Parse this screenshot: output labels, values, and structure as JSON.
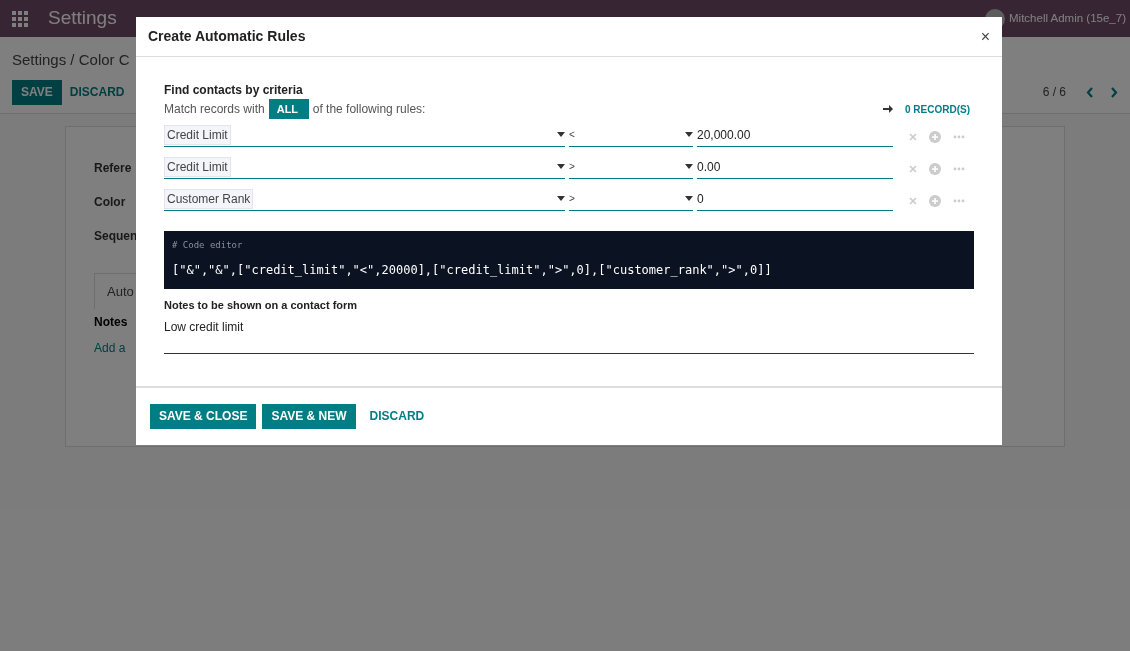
{
  "navbar": {
    "app_title": "Settings",
    "user": "Mitchell Admin (15e_7)"
  },
  "control_panel": {
    "breadcrumb": "Settings / Color C",
    "buttons": [
      {
        "label": "SAVE",
        "kind": "primary"
      },
      {
        "label": "DISCARD",
        "kind": "link"
      }
    ],
    "pager": "6 / 6"
  },
  "form": {
    "labels": [
      "Refere",
      "Color",
      "Sequen"
    ],
    "tab": "Auto",
    "table_header": "Notes",
    "add_line": "Add a"
  },
  "dialog": {
    "title": "Create Automatic Rules",
    "close": "×",
    "criteria_heading": "Find contacts by criteria",
    "match_prefix": "Match records with",
    "match_mode": "ALL",
    "match_suffix": "of the following rules:",
    "record_count": "0 RECORD(S)",
    "rules": [
      {
        "field": "Credit Limit",
        "operator": "<",
        "value": "20,000.00"
      },
      {
        "field": "Credit Limit",
        "operator": ">",
        "value": "0.00"
      },
      {
        "field": "Customer Rank",
        "operator": ">",
        "value": "0"
      }
    ],
    "code_comment": "# Code editor",
    "code": "[\"&\",\"&\",[\"credit_limit\",\"<\",20000],[\"credit_limit\",\">\",0],[\"customer_rank\",\">\",0]]",
    "notes_label": "Notes to be shown on a contact form",
    "notes_value": "Low credit limit",
    "buttons": [
      {
        "label": "SAVE & CLOSE",
        "kind": "primary"
      },
      {
        "label": "SAVE & NEW",
        "kind": "primary"
      },
      {
        "label": "DISCARD",
        "kind": "link"
      }
    ]
  }
}
